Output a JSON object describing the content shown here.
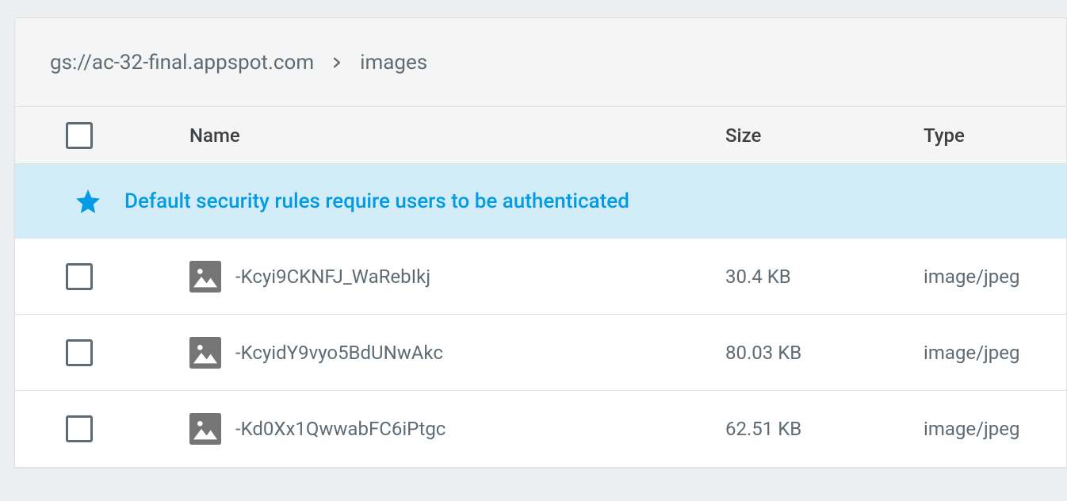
{
  "breadcrumb": {
    "root": "gs://ac-32-final.appspot.com",
    "current": "images"
  },
  "columns": {
    "name": "Name",
    "size": "Size",
    "type": "Type"
  },
  "banner": {
    "text": "Default security rules require users to be authenticated"
  },
  "files": [
    {
      "name": "-Kcyi9CKNFJ_WaRebIkj",
      "size": "30.4 KB",
      "type": "image/jpeg"
    },
    {
      "name": "-KcyidY9vyo5BdUNwAkc",
      "size": "80.03 KB",
      "type": "image/jpeg"
    },
    {
      "name": "-Kd0Xx1QwwabFC6iPtgc",
      "size": "62.51 KB",
      "type": "image/jpeg"
    }
  ]
}
